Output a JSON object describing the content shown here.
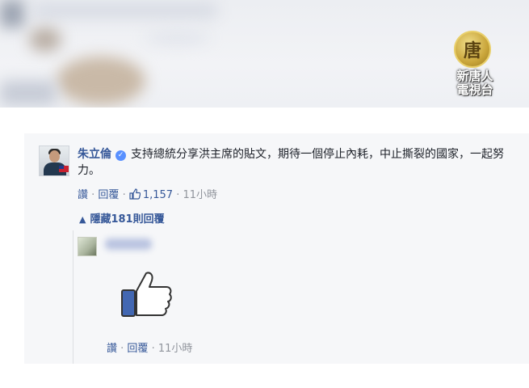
{
  "watermark": {
    "logo_char": "唐",
    "logo_text": "新唐人\n電視台"
  },
  "comment": {
    "author": "朱立倫",
    "text": "支持總統分享洪主席的貼文，期待一個停止內耗，中止撕裂的國家，一起努力。",
    "actions": {
      "like": "讚",
      "reply": "回覆",
      "like_count": "1,157",
      "time": "11小時"
    }
  },
  "replies_toggle": "隱藏181則回覆",
  "reply": {
    "sticker": "thumbs-up",
    "actions": {
      "like": "讚",
      "reply": "回覆",
      "time": "11小時"
    }
  },
  "colors": {
    "link": "#365899",
    "meta": "#90949c",
    "text": "#1d2129",
    "card_bg": "#f6f7f9",
    "thumb_blue": "#4267b2"
  }
}
